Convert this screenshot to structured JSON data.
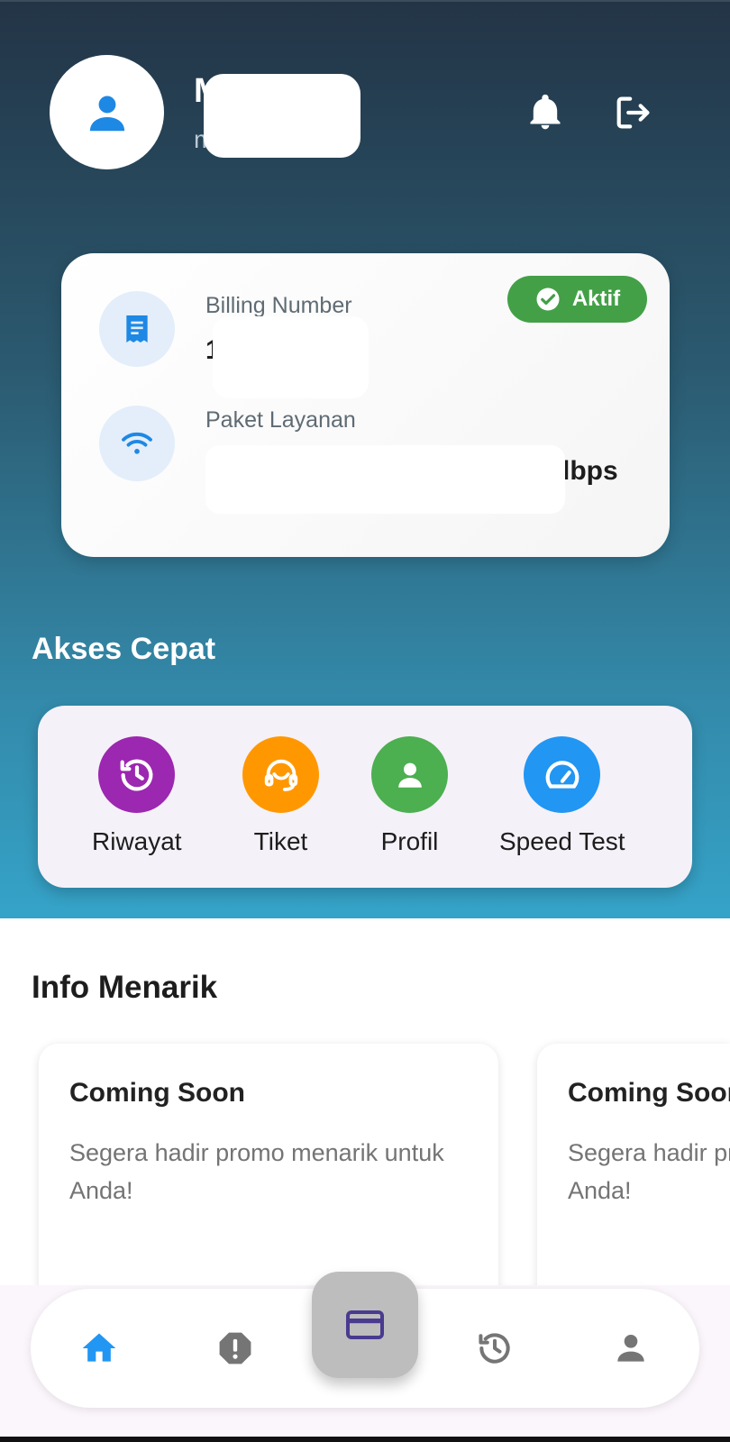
{
  "header": {
    "user_name": "M          tati",
    "user_email": "m           .com"
  },
  "billing_card": {
    "status": "Aktif",
    "billing_label": "Billing Number",
    "billing_value": "1          1",
    "package_label": "Paket Layanan",
    "package_value": "lbps"
  },
  "quick_access": {
    "title": "Akses Cepat",
    "items": [
      {
        "label": "Riwayat",
        "icon": "history-icon",
        "color": "#9c27b0"
      },
      {
        "label": "Tiket",
        "icon": "headset-icon",
        "color": "#ff9800"
      },
      {
        "label": "Profil",
        "icon": "person-icon",
        "color": "#4caf50"
      },
      {
        "label": "Speed Test",
        "icon": "speedometer-icon",
        "color": "#2196f3"
      }
    ]
  },
  "info": {
    "title": "Info Menarik",
    "cards": [
      {
        "title": "Coming Soon",
        "desc": "Segera hadir promo menarik untuk Anda!"
      },
      {
        "title": "Coming Soon",
        "desc": "Segera hadir promo menarik untuk Anda!"
      }
    ]
  },
  "bottom_nav": {
    "active_color": "#2196f3",
    "inactive_color": "#757575",
    "fab_icon_color": "#4a3b8f"
  }
}
